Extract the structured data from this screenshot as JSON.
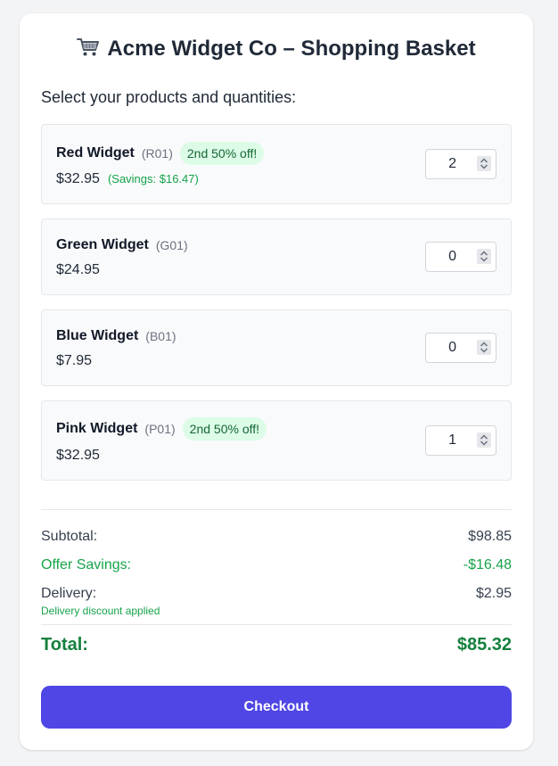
{
  "header": {
    "icon": "shopping-cart-icon",
    "title": "Acme Widget Co – Shopping Basket"
  },
  "subtitle": "Select your products and quantities:",
  "products": [
    {
      "name": "Red Widget",
      "code": "(R01)",
      "badge": "2nd 50% off!",
      "price": "$32.95",
      "savings": "(Savings: $16.47)",
      "quantity": "2"
    },
    {
      "name": "Green Widget",
      "code": "(G01)",
      "badge": "",
      "price": "$24.95",
      "savings": "",
      "quantity": "0"
    },
    {
      "name": "Blue Widget",
      "code": "(B01)",
      "badge": "",
      "price": "$7.95",
      "savings": "",
      "quantity": "0"
    },
    {
      "name": "Pink Widget",
      "code": "(P01)",
      "badge": "2nd 50% off!",
      "price": "$32.95",
      "savings": "",
      "quantity": "1"
    }
  ],
  "summary": {
    "subtotal_label": "Subtotal:",
    "subtotal_value": "$98.85",
    "savings_label": "Offer Savings:",
    "savings_value": "-$16.48",
    "delivery_label": "Delivery:",
    "delivery_value": "$2.95",
    "delivery_note": "Delivery discount applied",
    "total_label": "Total:",
    "total_value": "$85.32"
  },
  "checkout_label": "Checkout",
  "colors": {
    "accent": "#4f46e5",
    "savings_green": "#16a34a",
    "badge_bg": "#dcfce7"
  }
}
